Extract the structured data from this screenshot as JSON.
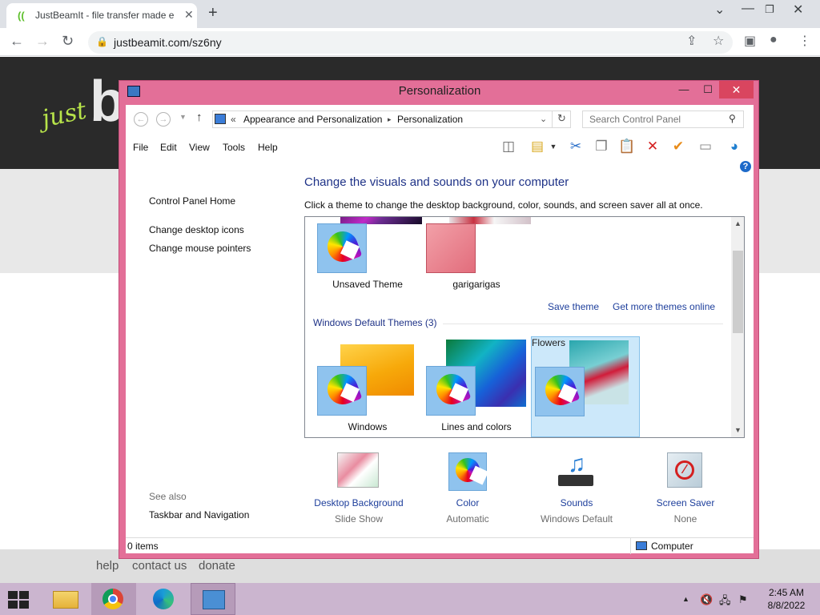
{
  "browser": {
    "tab_title": "JustBeamIt - file transfer made e",
    "url": "justbeamit.com/sz6ny"
  },
  "page": {
    "logo_just": "just",
    "logo_b": "b",
    "footer_links": [
      "help",
      "contact us",
      "donate"
    ]
  },
  "window": {
    "title": "Personalization",
    "breadcrumb": {
      "prefix": "«",
      "level1": "Appearance and Personalization",
      "sep": "▸",
      "level2": "Personalization"
    },
    "search_placeholder": "Search Control Panel",
    "menu": [
      "File",
      "Edit",
      "View",
      "Tools",
      "Help"
    ],
    "left_nav": {
      "home": "Control Panel Home",
      "links": [
        "Change desktop icons",
        "Change mouse pointers"
      ],
      "see_also": "See also",
      "see_also_links": [
        "Taskbar and Navigation"
      ]
    },
    "heading": "Change the visuals and sounds on your computer",
    "subheading": "Click a theme to change the desktop background, color, sounds, and screen saver all at once.",
    "my_themes": [
      {
        "name": "Unsaved Theme"
      },
      {
        "name": "garigarigas"
      }
    ],
    "save_theme": "Save theme",
    "get_more": "Get more themes online",
    "default_group": "Windows Default Themes (3)",
    "default_themes": [
      {
        "name": "Windows"
      },
      {
        "name": "Lines and colors"
      },
      {
        "name": "Flowers",
        "selected": true
      }
    ],
    "bottom": [
      {
        "title": "Desktop Background",
        "value": "Slide Show",
        "icon": "desktop-background-icon"
      },
      {
        "title": "Color",
        "value": "Automatic",
        "icon": "color-icon"
      },
      {
        "title": "Sounds",
        "value": "Windows Default",
        "icon": "sounds-icon"
      },
      {
        "title": "Screen Saver",
        "value": "None",
        "icon": "screen-saver-icon"
      }
    ],
    "status_items": "0 items",
    "status_location": "Computer"
  },
  "taskbar": {
    "time": "2:45 AM",
    "date": "8/8/2022"
  },
  "colors": {
    "window_frame": "#e36f98",
    "taskbar": "#cbb5cf",
    "link": "#1e3f9c",
    "heading": "#1e3287"
  }
}
